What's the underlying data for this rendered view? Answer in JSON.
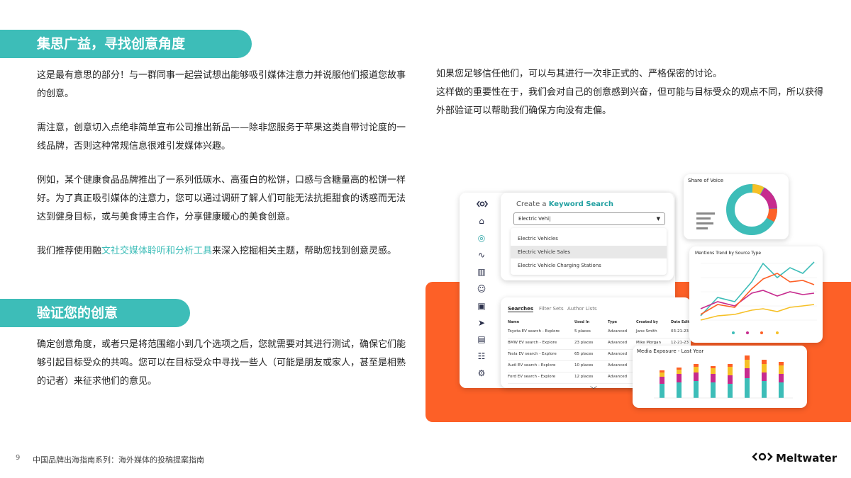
{
  "section1": {
    "title": "集思广益，寻找创意角度",
    "p1": "这是最有意思的部分！与一群同事一起尝试想出能够吸引媒体注意力并说服他们报道您故事的创意。",
    "p2": "需注意，创意切入点绝非简单宣布公司推出新品——除非您服务于苹果这类自带讨论度的一线品牌，否则这种常规信息很难引发媒体兴趣。",
    "p3": "例如，某个健康食品品牌推出了一系列低碳水、高蛋白的松饼，口感与含糖量高的松饼一样好。为了真正吸引媒体的注意力，您可以通过调研了解人们可能无法抗拒甜食的诱惑而无法达到健身目标，或与美食博主合作，分享健康暖心的美食创意。",
    "p4_pre": "我们推荐使用融",
    "p4_link": "文社交媒体聆听和分析工具",
    "p4_post": "来深入挖掘相关主题，帮助您找到创意灵感。"
  },
  "section2": {
    "title": "验证您的创意",
    "p1": "确定创意角度，或者只是将范围缩小到几个选项之后，您就需要对其进行测试，确保它们能够引起目标受众的共鸣。您可以在目标受众中寻找一些人（可能是朋友或家人，甚至是相熟的记者）来征求他们的意见。"
  },
  "right": {
    "p1": "如果您足够信任他们，可以与其进行一次非正式的、严格保密的讨论。",
    "p2": "这样做的重要性在于，我们会对自己的创意感到兴奋，但可能与目标受众的观点不同，所以获得外部验证可以帮助我们确保方向没有走偏。"
  },
  "ui": {
    "search_title_pre": "Create a ",
    "search_title_bold": "Keyword Search",
    "search_value": "Electric Vehi|",
    "dropdown": [
      "Electric Vehicles",
      "Electric Vehicle Sales",
      "Electric Vehicle Charging Stations"
    ],
    "tabs": [
      "Searches",
      "Filter Sets",
      "Author Lists"
    ],
    "table_headers": [
      "Name",
      "Used In",
      "Type",
      "Created by",
      "Date Edited"
    ],
    "table_rows": [
      [
        "Toyota EV search - Explore",
        "5 places",
        "Advanced",
        "Jane Smith",
        "03-21-23"
      ],
      [
        "BMW EV search - Explore",
        "23 places",
        "Advanced",
        "Mike Morgan",
        "12-21-23"
      ],
      [
        "Tesla EV search - Explore",
        "65 places",
        "Advanced",
        "",
        ""
      ],
      [
        "Audi EV search - Explore",
        "10 places",
        "Advanced",
        "",
        ""
      ],
      [
        "Ford EV search - Explore",
        "12 places",
        "Advanced",
        "",
        ""
      ]
    ],
    "sov_title": "Share of Voice",
    "trend_title": "Mentions Trend by Source Type",
    "exposure_title": "Media Exposure - Last Year"
  },
  "footer": {
    "page": "9",
    "title": "中国品牌出海指南系列：海外媒体的投稿提案指南",
    "brand": "Meltwater"
  },
  "colors": {
    "teal": "#3dbdb8",
    "orange": "#fd6027",
    "magenta": "#c72b8e",
    "yellow": "#f6c026"
  }
}
